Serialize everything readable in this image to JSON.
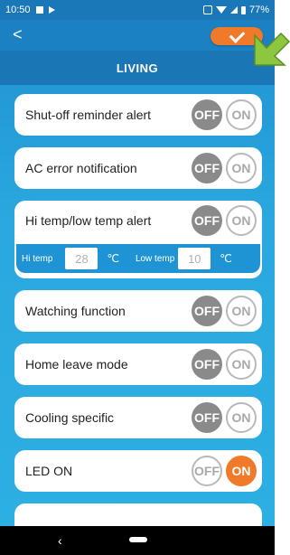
{
  "status": {
    "time": "10:50",
    "battery": "77%"
  },
  "screen": {
    "title": "LIVING"
  },
  "toolbar": {
    "back_glyph": "<"
  },
  "settings": [
    {
      "label": "Shut-off reminder alert",
      "off": "OFF",
      "on": "ON",
      "state": "off"
    },
    {
      "label": "AC error notification",
      "off": "OFF",
      "on": "ON",
      "state": "off"
    },
    {
      "label": "Hi temp/low temp alert",
      "off": "OFF",
      "on": "ON",
      "state": "off"
    },
    {
      "label": "Watching function",
      "off": "OFF",
      "on": "ON",
      "state": "off"
    },
    {
      "label": "Home leave mode",
      "off": "OFF",
      "on": "ON",
      "state": "off"
    },
    {
      "label": "Cooling specific",
      "off": "OFF",
      "on": "ON",
      "state": "off"
    },
    {
      "label": "LED ON",
      "off": "OFF",
      "on": "ON",
      "state": "on"
    }
  ],
  "temp": {
    "hi_label": "Hi temp",
    "hi_value": "28",
    "hi_unit": "℃",
    "low_label": "Low temp",
    "low_value": "10",
    "low_unit": "℃"
  },
  "nav": {
    "back_glyph": "‹"
  },
  "colors": {
    "accent": "#f07a2a",
    "header": "#1b76b6",
    "off_active": "#8a8a8a"
  }
}
